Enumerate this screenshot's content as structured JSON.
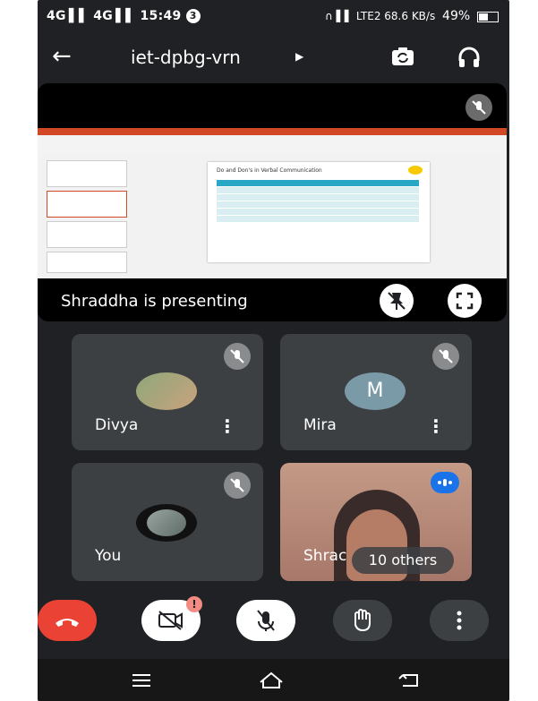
{
  "status_bar": {
    "signal": "4G ▌▌ 4G ▌▌",
    "time": "15:49",
    "notification_count": "3",
    "right": "∩  ▌▌  LTE2  68.6 KB/s",
    "battery": "49%"
  },
  "meeting": {
    "code": "iet-dpbg-vrn"
  },
  "presentation": {
    "caption": "Shraddha is presenting",
    "slide_title": "Do and Don's in Verbal Communication"
  },
  "participants": [
    {
      "name": "Divya"
    },
    {
      "name": "Mira",
      "initial": "M"
    },
    {
      "name": "You"
    },
    {
      "name": "Shrac",
      "others": "10 others"
    }
  ],
  "controls": {
    "end_call_color": "#ea4335",
    "notification_badge": "!"
  },
  "colors": {
    "background": "#202124",
    "tile": "#3c4043",
    "accent_blue": "#1a73e8",
    "mira_avatar": "#7b9aa7"
  }
}
